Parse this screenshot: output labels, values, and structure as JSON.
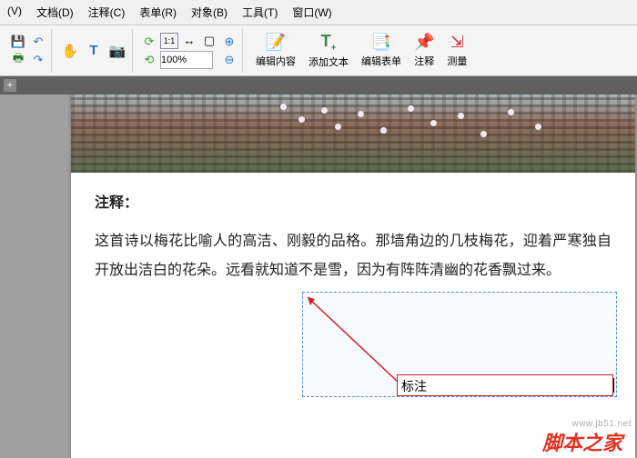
{
  "menu": {
    "view": "(V)",
    "document": "文档(D)",
    "comment": "注释(C)",
    "form": "表单(R)",
    "object": "对象(B)",
    "tool": "工具(T)",
    "window": "窗口(W)"
  },
  "toolbar": {
    "zoom_value": "100%",
    "edit_content": "编辑内容",
    "add_text": "添加文本",
    "edit_form": "编辑表单",
    "annotations": "注释",
    "measure": "测量"
  },
  "document": {
    "heading": "注释：",
    "body": "这首诗以梅花比喻人的高洁、刚毅的品格。那墙角边的几枝梅花，迎着严寒独自开放出洁白的花朵。远看就知道不是雪，因为有阵阵清幽的花香飘过来。",
    "annotation_text": "标注"
  },
  "footer": {
    "watermark": "www.jb51.net",
    "stamp": "脚本之家"
  }
}
